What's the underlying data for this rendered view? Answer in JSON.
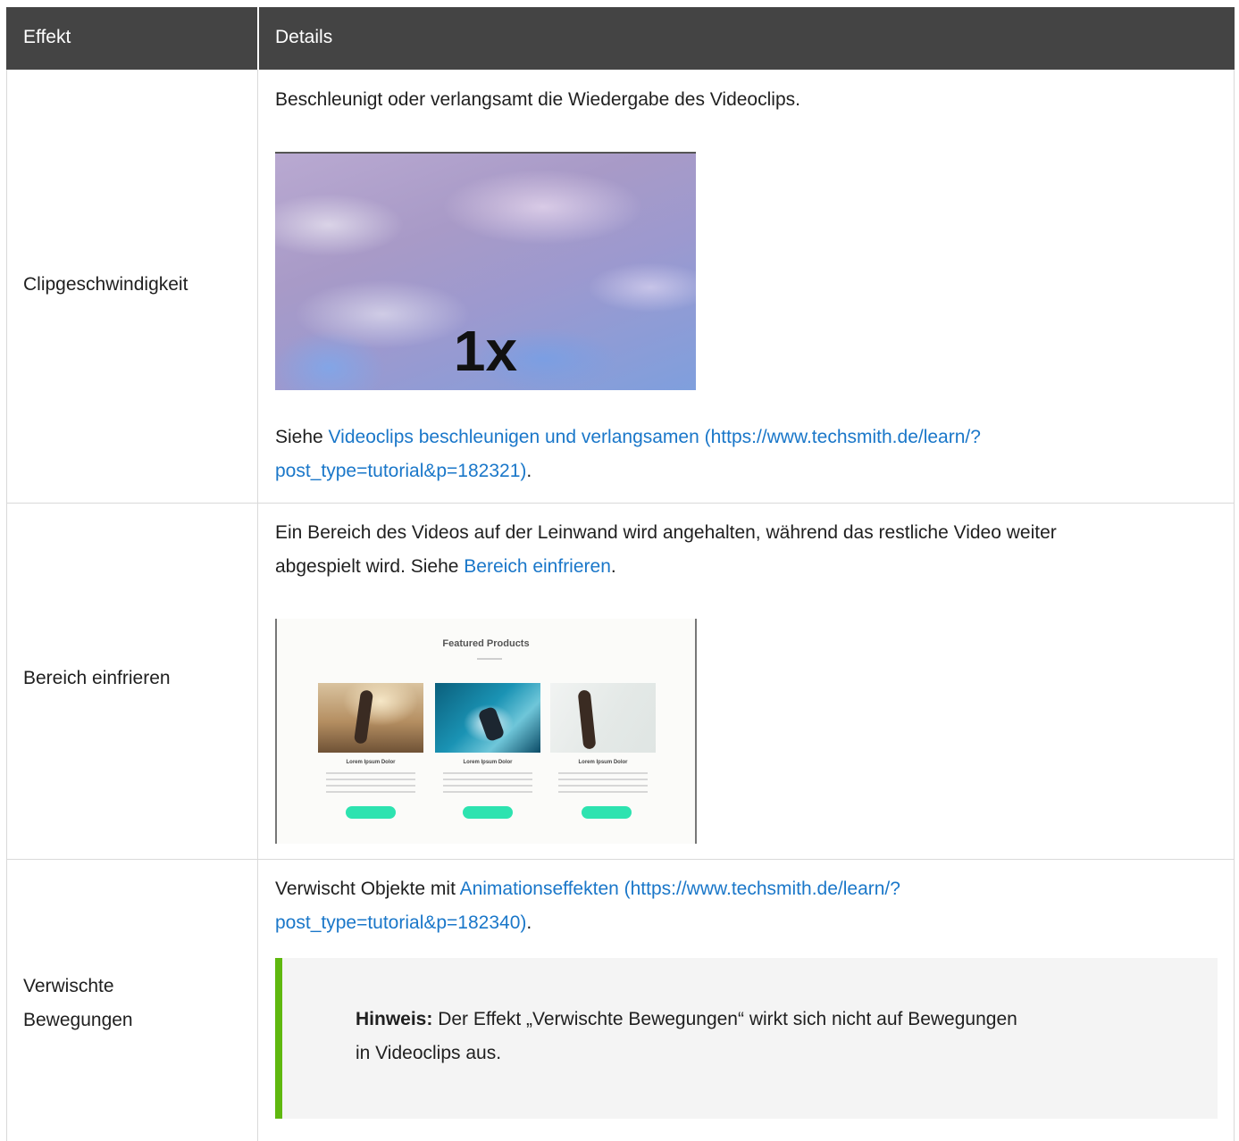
{
  "header": {
    "col1": "Effekt",
    "col2": "Details"
  },
  "rows": [
    {
      "effekt": "Clipgeschwindigkeit",
      "text": "Beschleunigt oder verlangsamt die Wiedergabe des Videoclips.",
      "image_label": "1x",
      "see_prefix": "Siehe ",
      "link_line1": "Videoclips beschleunigen und verlangsamen (https://www.techsmith.de/learn/?",
      "link_line2": "post_type=tutorial&p=182321)",
      "see_suffix": "."
    },
    {
      "effekt": "Bereich einfrieren",
      "text_line1": "Ein Bereich des Videos auf der Leinwand wird angehalten, während das restliche Video weiter",
      "text_line2_prefix": "abgespielt wird. Siehe ",
      "link": "Bereich einfrieren",
      "text_line2_suffix": ".",
      "image_title": "Featured Products",
      "image_caption": "Lorem Ipsum Dolor"
    },
    {
      "effekt_line1": "Verwischte",
      "effekt_line2": "Bewegungen",
      "text_prefix": "Verwischt Objekte mit ",
      "link_line1": "Animationseffekten (https://www.techsmith.de/learn/?",
      "link_line2": "post_type=tutorial&p=182340)",
      "text_suffix": ".",
      "note_label": "Hinweis:",
      "note_line1": " Der Effekt „Verwischte Bewegungen“ wirkt sich nicht auf Bewegungen",
      "note_line2": "in Videoclips aus."
    }
  ],
  "colors": {
    "header_bg": "#444444",
    "link": "#1a77c9",
    "note_accent": "#5fb80f",
    "note_bg": "#f4f4f4"
  }
}
